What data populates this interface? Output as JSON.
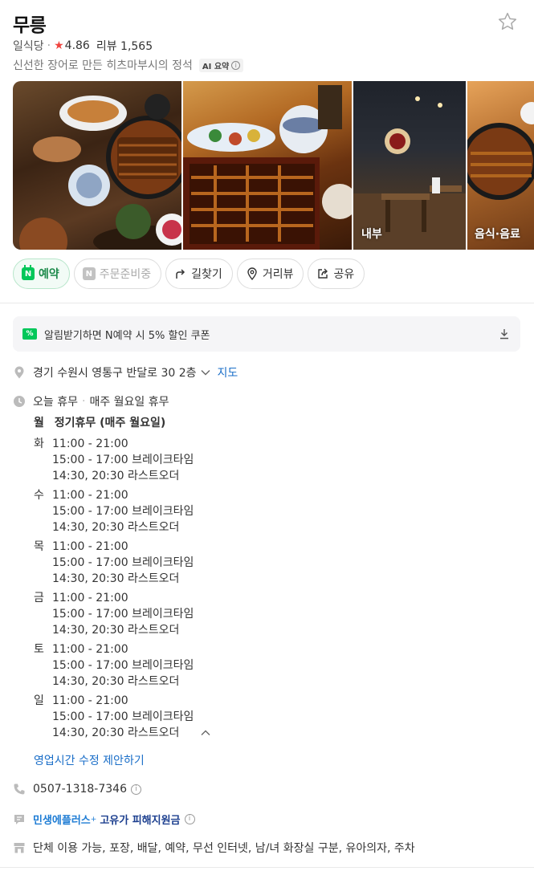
{
  "place": {
    "name": "무릉",
    "category": "일식당",
    "rating": "4.86",
    "review_label": "리뷰 1,565",
    "description": "신선한 장어로 만든 히츠마부시의 정석",
    "ai_tag": "AI 요약"
  },
  "photos": [
    {
      "label": ""
    },
    {
      "label": ""
    },
    {
      "label": "내부"
    },
    {
      "label": "음식·음료"
    }
  ],
  "actions": {
    "reserve": "예약",
    "order": "주문준비중",
    "directions": "길찾기",
    "street_view": "거리뷰",
    "share": "공유"
  },
  "coupon": {
    "icon_text": "%",
    "text": "알림받기하면 N예약 시 5% 할인 쿠폰"
  },
  "address": {
    "text": "경기 수원시 영통구 반달로 30 2층",
    "map_link": "지도"
  },
  "hours_summary": {
    "status": "오늘 휴무",
    "note": "매주 월요일 휴무"
  },
  "hours": {
    "monday": {
      "day": "월",
      "text": "정기휴무 (매주 월요일)"
    },
    "days": [
      {
        "day": "화",
        "open": "11:00 - 21:00",
        "break": "15:00 - 17:00 브레이크타임",
        "last": "14:30, 20:30 라스트오더"
      },
      {
        "day": "수",
        "open": "11:00 - 21:00",
        "break": "15:00 - 17:00 브레이크타임",
        "last": "14:30, 20:30 라스트오더"
      },
      {
        "day": "목",
        "open": "11:00 - 21:00",
        "break": "15:00 - 17:00 브레이크타임",
        "last": "14:30, 20:30 라스트오더"
      },
      {
        "day": "금",
        "open": "11:00 - 21:00",
        "break": "15:00 - 17:00 브레이크타임",
        "last": "14:30, 20:30 라스트오더"
      },
      {
        "day": "토",
        "open": "11:00 - 21:00",
        "break": "15:00 - 17:00 브레이크타임",
        "last": "14:30, 20:30 라스트오더"
      },
      {
        "day": "일",
        "open": "11:00 - 21:00",
        "break": "15:00 - 17:00 브레이크타임",
        "last": "14:30, 20:30 라스트오더"
      }
    ],
    "suggest_edit": "영업시간 수정 제안하기"
  },
  "phone": "0507-1318-7346",
  "promo": {
    "brand": "민생에플러스",
    "plus_mark": "+",
    "label": "고유가 피해지원금"
  },
  "amenities": "단체 이용 가능, 포장, 배달, 예약, 무선 인터넷, 남/녀 화장실 구분, 유아의자, 주차",
  "colors": {
    "naver_green": "#03c75a",
    "link_blue": "#1a6ec8",
    "star_red": "#f0443f"
  },
  "icons": {
    "save": "star-outline-icon",
    "address": "location-pin-icon",
    "hours": "clock-icon",
    "phone": "phone-icon",
    "promo": "message-icon",
    "amenities": "store-icon"
  }
}
